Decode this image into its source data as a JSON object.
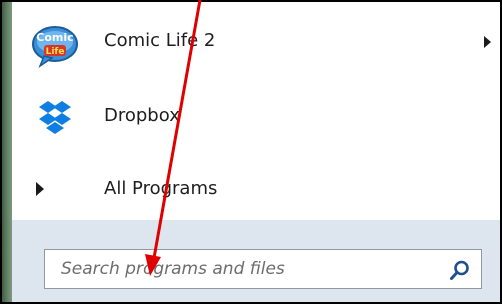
{
  "menu": {
    "items": [
      {
        "label": "Comic Life 2",
        "icon": "comic-life-icon",
        "has_submenu": true
      },
      {
        "label": "Dropbox",
        "icon": "dropbox-icon",
        "has_submenu": false
      }
    ],
    "all_programs_label": "All Programs"
  },
  "search": {
    "placeholder": "Search programs and files",
    "icon": "search-icon"
  },
  "colors": {
    "annotation_arrow": "#e00000",
    "menu_bottom_bg": "#dde5ee",
    "dropbox_blue": "#0f7ee3"
  }
}
